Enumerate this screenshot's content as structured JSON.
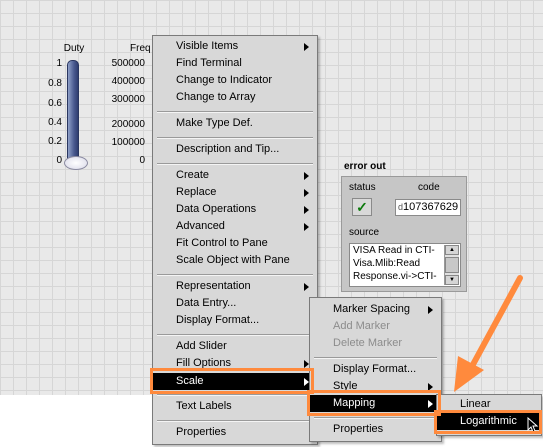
{
  "duty": {
    "label": "Duty",
    "ticks": [
      "1",
      "0.8",
      "0.6",
      "0.4",
      "0.2",
      "0"
    ]
  },
  "frequency": {
    "label": "Freq",
    "ticks": [
      "500000",
      "400000",
      "300000",
      "200000",
      "100000",
      "0"
    ]
  },
  "error_out": {
    "title": "error out",
    "status_label": "status",
    "code_label": "code",
    "code_prefix": "d",
    "code_value": "107367629",
    "source_label": "source",
    "source_lines": [
      "VISA Read in CTI-",
      "Visa.Mlib:Read",
      "Response.vi->CTI-"
    ]
  },
  "main_menu": {
    "items": [
      {
        "label": "Visible Items",
        "submenu": true
      },
      {
        "label": "Find Terminal"
      },
      {
        "label": "Change to Indicator"
      },
      {
        "label": "Change to Array"
      },
      {
        "label": "Make Type Def."
      },
      {
        "label": "Description and Tip..."
      },
      {
        "label": "Create",
        "submenu": true
      },
      {
        "label": "Replace",
        "submenu": true
      },
      {
        "label": "Data Operations",
        "submenu": true
      },
      {
        "label": "Advanced",
        "submenu": true
      },
      {
        "label": "Fit Control to Pane"
      },
      {
        "label": "Scale Object with Pane"
      },
      {
        "label": "Representation",
        "submenu": true
      },
      {
        "label": "Data Entry..."
      },
      {
        "label": "Display Format..."
      },
      {
        "label": "Add Slider"
      },
      {
        "label": "Fill Options",
        "submenu": true
      },
      {
        "label": "Scale",
        "submenu": true,
        "highlighted": true
      },
      {
        "label": "Text Labels"
      },
      {
        "label": "Properties"
      }
    ]
  },
  "scale_menu": {
    "items": [
      {
        "label": "Marker Spacing",
        "submenu": true
      },
      {
        "label": "Add Marker",
        "disabled": true
      },
      {
        "label": "Delete Marker",
        "disabled": true
      },
      {
        "label": "Display Format..."
      },
      {
        "label": "Style",
        "submenu": true
      },
      {
        "label": "Mapping",
        "submenu": true,
        "highlighted": true
      },
      {
        "label": "Properties"
      }
    ]
  },
  "mapping_menu": {
    "items": [
      {
        "label": "Linear"
      },
      {
        "label": "Logarithmic",
        "highlighted": true
      }
    ]
  },
  "colors": {
    "highlight_outline": "#ff8a3d",
    "menu_bg": "#d8d8d8",
    "selection_bg": "#000000",
    "status_ok": "#0d7a0d"
  }
}
